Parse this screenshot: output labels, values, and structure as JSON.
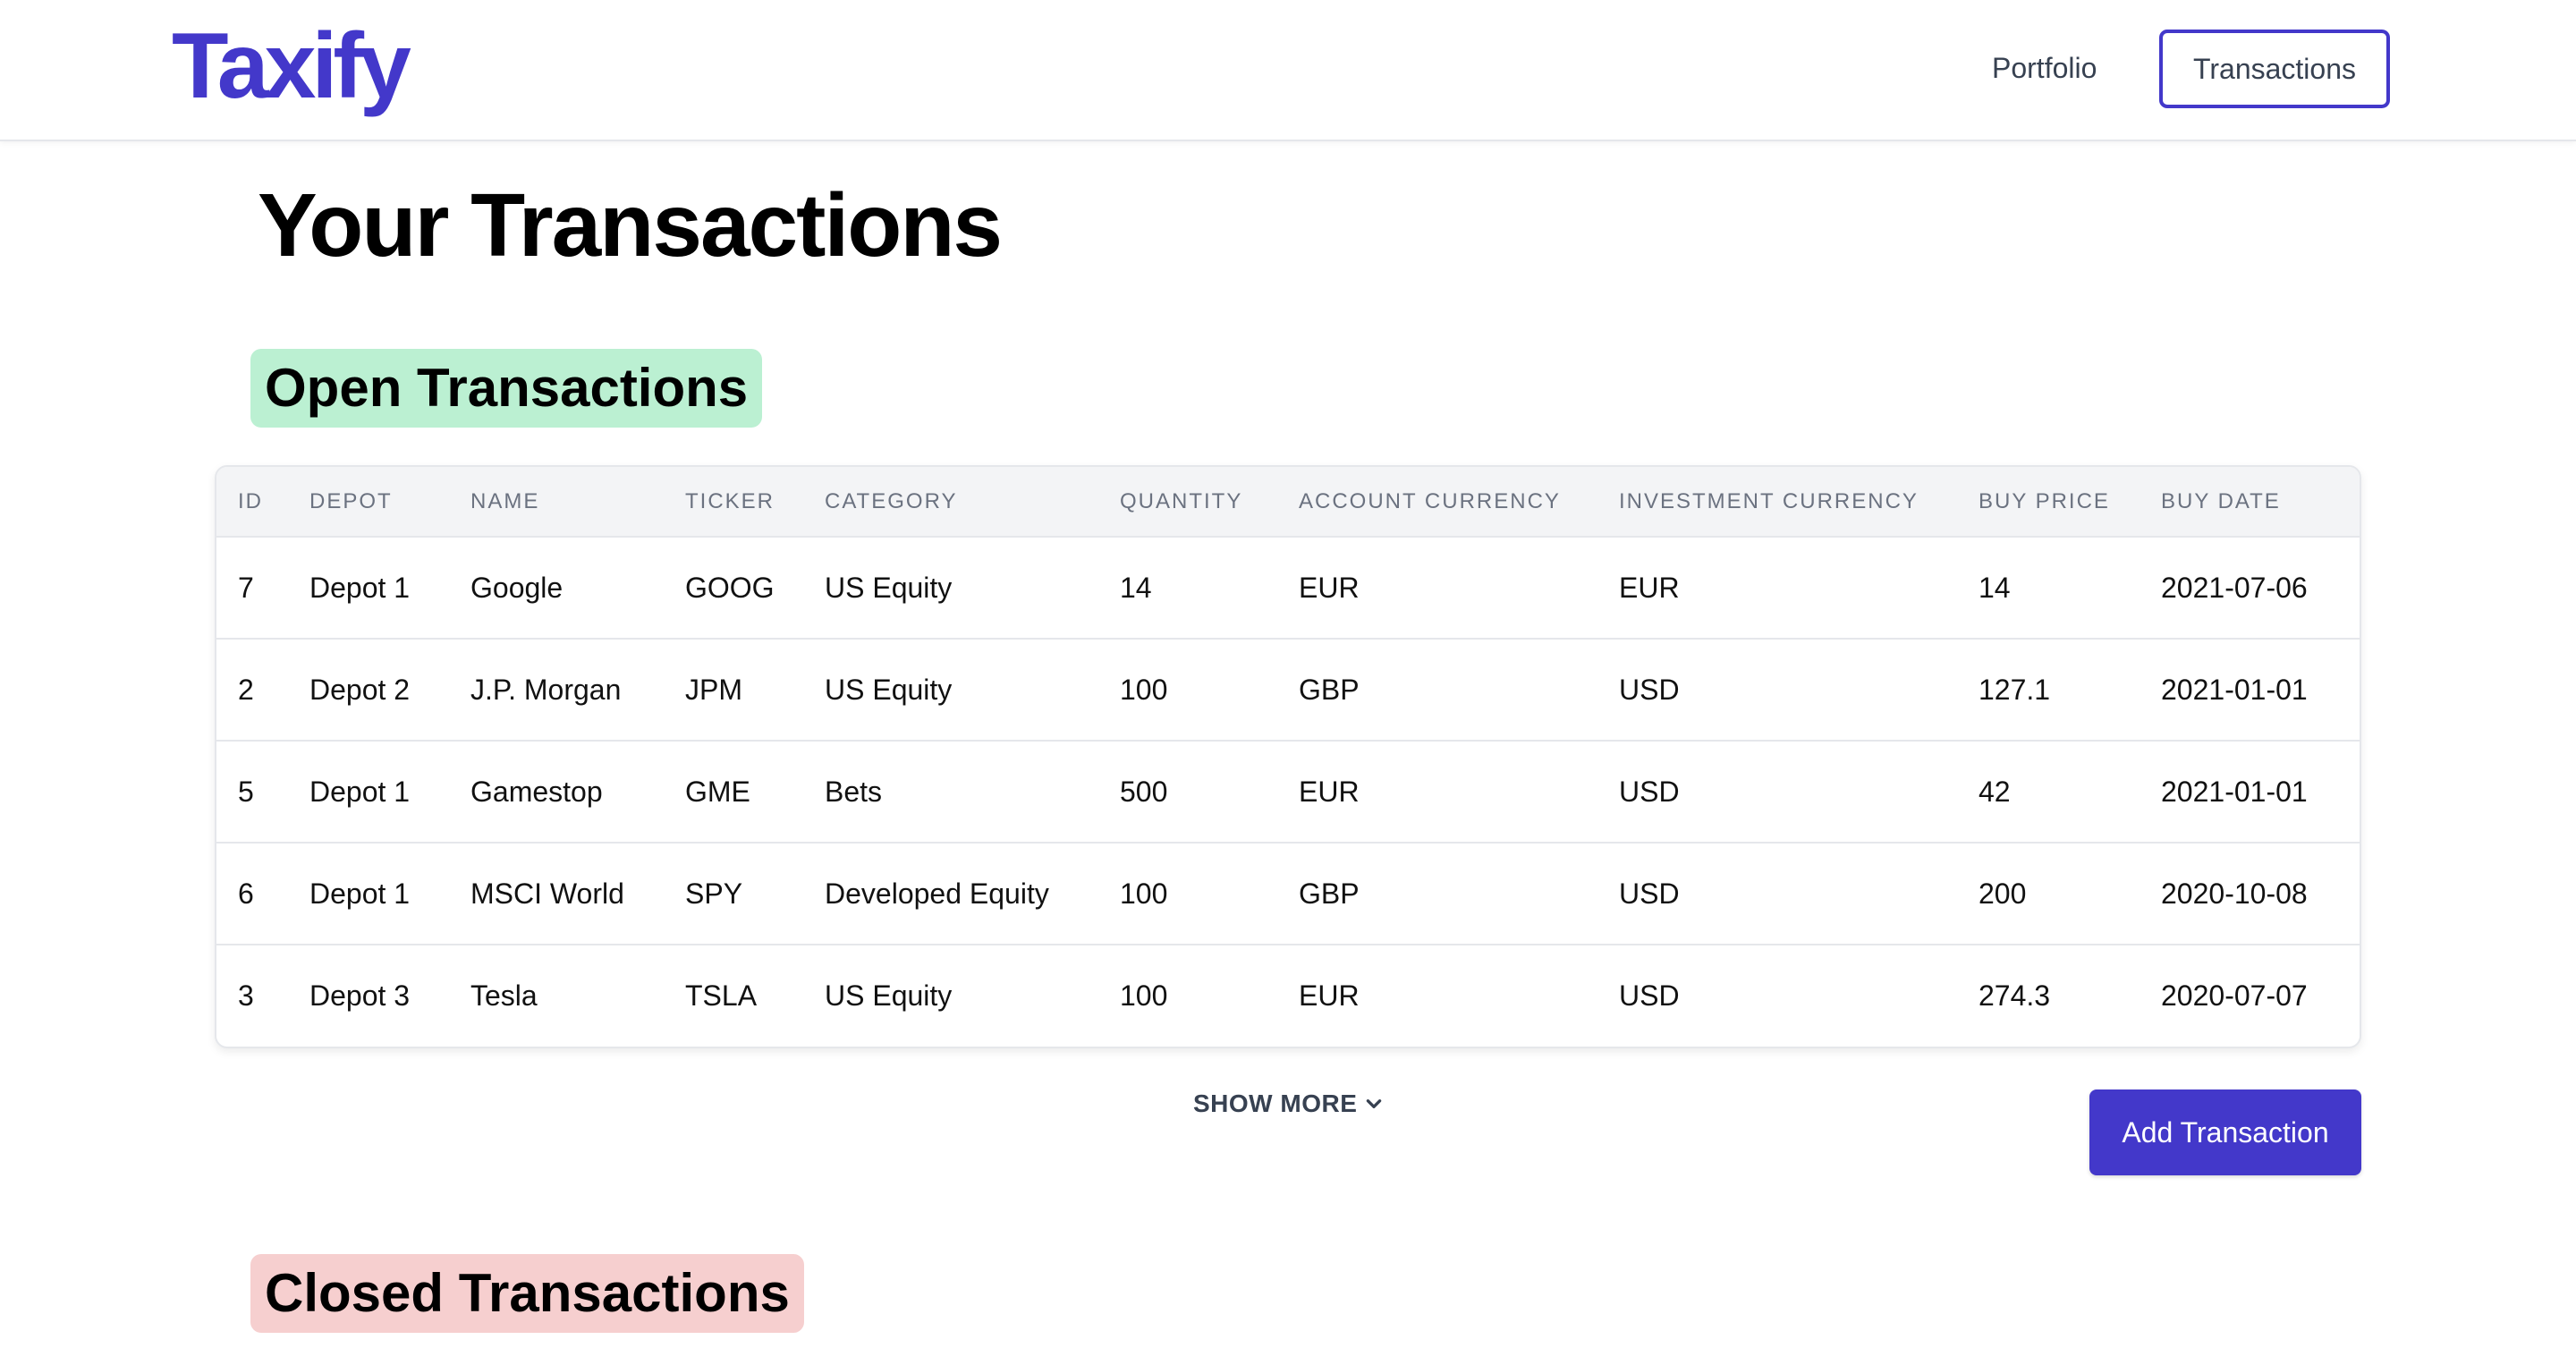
{
  "app": {
    "logo": "Taxify",
    "accent_color": "#4338ca"
  },
  "nav": {
    "portfolio_label": "Portfolio",
    "transactions_label": "Transactions"
  },
  "page": {
    "title": "Your Transactions"
  },
  "open_section": {
    "title": "Open Transactions",
    "badge_color": "#bbf0d2",
    "columns": [
      "ID",
      "DEPOT",
      "NAME",
      "TICKER",
      "CATEGORY",
      "QUANTITY",
      "ACCOUNT CURRENCY",
      "INVESTMENT CURRENCY",
      "BUY PRICE",
      "BUY DATE"
    ],
    "rows": [
      [
        "7",
        "Depot 1",
        "Google",
        "GOOG",
        "US Equity",
        "14",
        "EUR",
        "EUR",
        "14",
        "2021-07-06"
      ],
      [
        "2",
        "Depot 2",
        "J.P. Morgan",
        "JPM",
        "US Equity",
        "100",
        "GBP",
        "USD",
        "127.1",
        "2021-01-01"
      ],
      [
        "5",
        "Depot 1",
        "Gamestop",
        "GME",
        "Bets",
        "500",
        "EUR",
        "USD",
        "42",
        "2021-01-01"
      ],
      [
        "6",
        "Depot 1",
        "MSCI World",
        "SPY",
        "Developed Equity",
        "100",
        "GBP",
        "USD",
        "200",
        "2020-10-08"
      ],
      [
        "3",
        "Depot 3",
        "Tesla",
        "TSLA",
        "US Equity",
        "100",
        "EUR",
        "USD",
        "274.3",
        "2020-07-07"
      ]
    ],
    "show_more_label": "SHOW MORE",
    "show_more_icon": "chevron-down-icon",
    "add_button_label": "Add Transaction"
  },
  "closed_section": {
    "title": "Closed Transactions",
    "badge_color": "#f6cfcf"
  }
}
